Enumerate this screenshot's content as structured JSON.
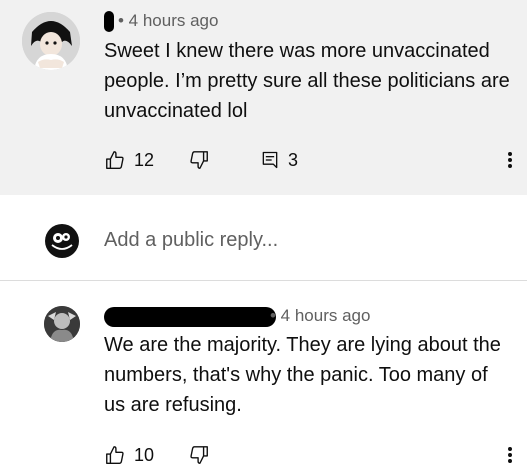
{
  "comment1": {
    "meta": "• 4 hours ago",
    "text": "Sweet I knew there was more unvaccinated people. I’m pretty sure all these politicians are unvaccinated lol",
    "likes": "12",
    "replies": "3"
  },
  "reply_box": {
    "placeholder": "Add a public reply..."
  },
  "comment2": {
    "meta": "• 4 hours ago",
    "text": "We are the majority. They are lying about the numbers, that's why the panic. Too many of us are refusing.",
    "likes": "10"
  },
  "icons": {
    "like": "thumbs-up-icon",
    "dislike": "thumbs-down-icon",
    "reply": "reply-icon",
    "more": "more-vertical-icon"
  },
  "colors": {
    "highlight_bg": "#f1f1f1",
    "text": "#0f0f0f",
    "secondary_text": "#606060"
  }
}
